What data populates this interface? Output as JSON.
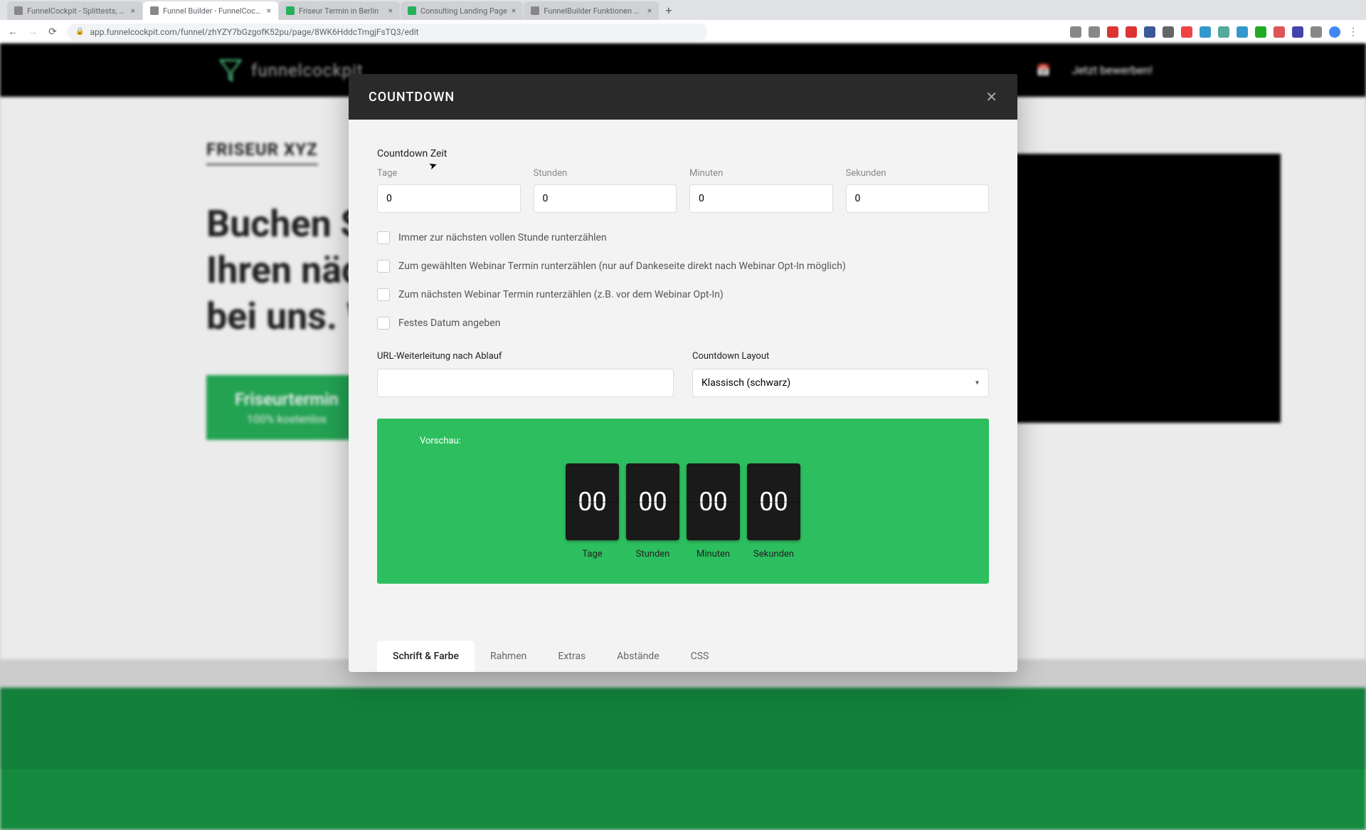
{
  "browser": {
    "tabs": [
      {
        "title": "FunnelCockpit - Splittests, Ma"
      },
      {
        "title": "Funnel Builder - FunnelCockpit"
      },
      {
        "title": "Friseur Termin in Berlin"
      },
      {
        "title": "Consulting Landing Page"
      },
      {
        "title": "FunnelBuilder Funktionen & El"
      }
    ],
    "url": "app.funnelcockpit.com/funnel/zhYZY7bGzgofK52pu/page/8WK6HddcTmgjFsTQ3/edit"
  },
  "page": {
    "logo_text": "funnelcockpit",
    "nav_apply": "Jetzt bewerben!",
    "salon_title": "FRISEUR XYZ",
    "hero_line1": "Buchen Si",
    "hero_line2": "Ihren näch",
    "hero_line3": "bei uns. W",
    "cta_main": "Friseurtermin",
    "cta_sub": "100% kostenlos"
  },
  "modal": {
    "title": "COUNTDOWN",
    "section_label": "Countdown Zeit",
    "time_fields": {
      "days_label": "Tage",
      "days_value": "0",
      "hours_label": "Stunden",
      "hours_value": "0",
      "minutes_label": "Minuten",
      "minutes_value": "0",
      "seconds_label": "Sekunden",
      "seconds_value": "0"
    },
    "checkboxes": {
      "cb1": "Immer zur nächsten vollen Stunde runterzählen",
      "cb2": "Zum gewählten Webinar Termin runterzählen (nur auf Dankeseite direkt nach Webinar Opt-In möglich)",
      "cb3": "Zum nächsten Webinar Termin runterzählen (z.B. vor dem Webinar Opt-In)",
      "cb4": "Festes Datum angeben"
    },
    "url_label": "URL-Weiterleitung nach Ablauf",
    "layout_label": "Countdown Layout",
    "layout_value": "Klassisch (schwarz)",
    "preview_label": "Vorschau:",
    "preview": {
      "days": "00",
      "hours": "00",
      "minutes": "00",
      "seconds": "00",
      "days_caption": "Tage",
      "hours_caption": "Stunden",
      "minutes_caption": "Minuten",
      "seconds_caption": "Sekunden"
    },
    "tabs": {
      "t1": "Schrift & Farbe",
      "t2": "Rahmen",
      "t3": "Extras",
      "t4": "Abstände",
      "t5": "CSS"
    }
  }
}
